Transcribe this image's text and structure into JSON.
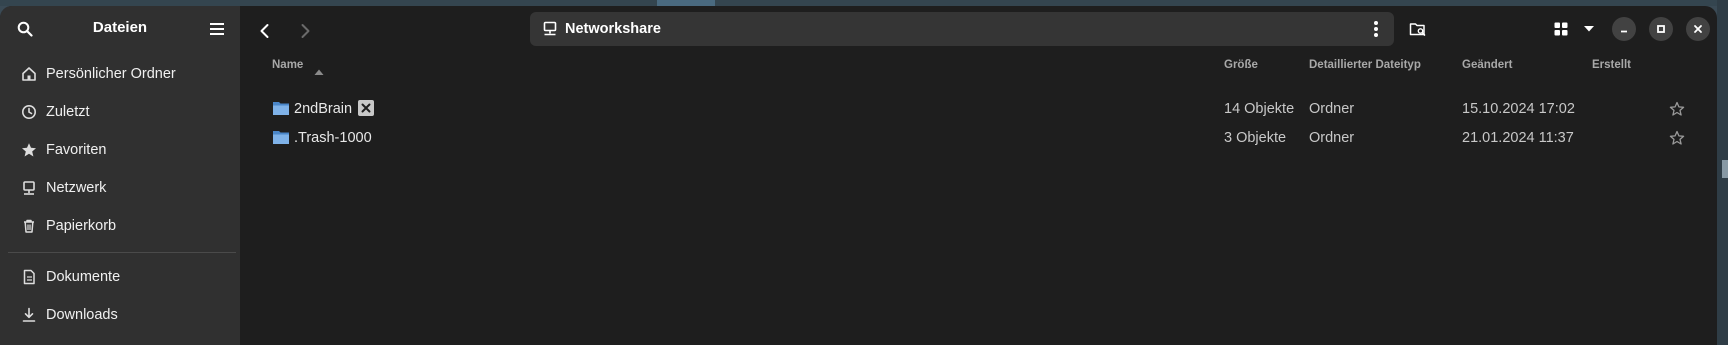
{
  "sidebar": {
    "title": "Dateien",
    "items": [
      {
        "label": "Persönlicher Ordner",
        "icon": "home-icon"
      },
      {
        "label": "Zuletzt",
        "icon": "clock-icon"
      },
      {
        "label": "Favoriten",
        "icon": "star-icon"
      },
      {
        "label": "Netzwerk",
        "icon": "network-icon"
      },
      {
        "label": "Papierkorb",
        "icon": "trash-icon"
      },
      {
        "label": "Dokumente",
        "icon": "document-icon"
      },
      {
        "label": "Downloads",
        "icon": "download-icon"
      }
    ]
  },
  "header": {
    "path": "Networkshare"
  },
  "columns": {
    "name": "Name",
    "size": "Größe",
    "type": "Detaillierter Dateityp",
    "modified": "Geändert",
    "created": "Erstellt"
  },
  "files": [
    {
      "name": "2ndBrain",
      "size": "14 Objekte",
      "type": "Ordner",
      "modified": "15.10.2024 17:02",
      "created": "",
      "badge": "close-badge-icon"
    },
    {
      "name": ".Trash-1000",
      "size": "3 Objekte",
      "type": "Ordner",
      "modified": "21.01.2024 11:37",
      "created": ""
    }
  ],
  "colors": {
    "window_bg": "#1e1e1e",
    "sidebar_bg": "#303030",
    "folder_blue": "#7fb2e8"
  }
}
